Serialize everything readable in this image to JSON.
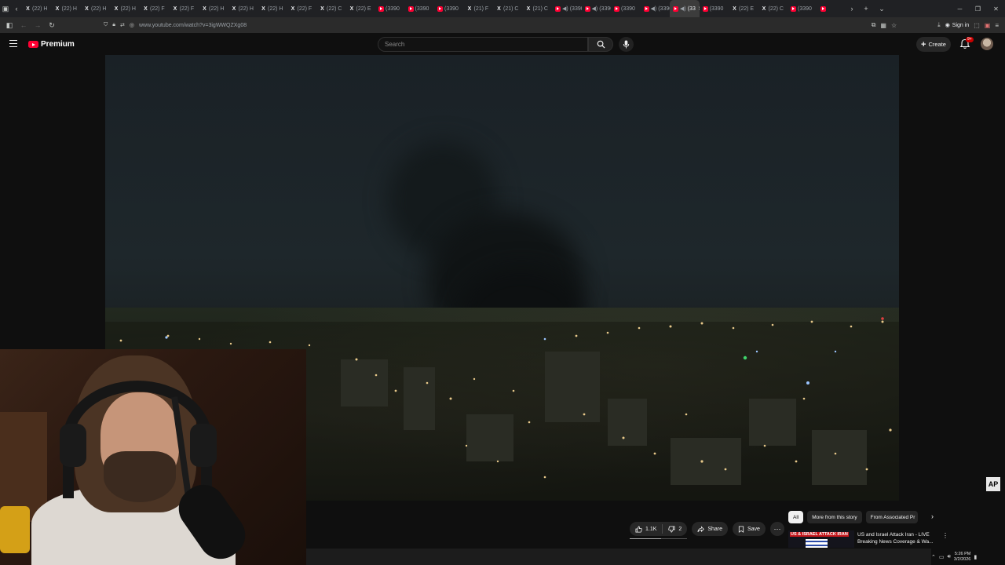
{
  "browser": {
    "tabs": [
      {
        "label": "(22) H",
        "icon": "x-icon"
      },
      {
        "label": "(22) H",
        "icon": "x-icon"
      },
      {
        "label": "(22) H",
        "icon": "x-icon"
      },
      {
        "label": "(22) H",
        "icon": "x-icon"
      },
      {
        "label": "(22) F",
        "icon": "x-icon"
      },
      {
        "label": "(22) F",
        "icon": "x-icon"
      },
      {
        "label": "(22) H",
        "icon": "x-icon"
      },
      {
        "label": "(22) H",
        "icon": "x-icon"
      },
      {
        "label": "(22) H",
        "icon": "x-icon"
      },
      {
        "label": "(22) F",
        "icon": "x-icon"
      },
      {
        "label": "(22) C",
        "icon": "x-icon"
      },
      {
        "label": "(22) E",
        "icon": "x-icon"
      },
      {
        "label": "(3390",
        "icon": "youtube-icon"
      },
      {
        "label": "(3390",
        "icon": "youtube-icon"
      },
      {
        "label": "(3390",
        "icon": "youtube-icon"
      },
      {
        "label": "(21) F",
        "icon": "x-icon"
      },
      {
        "label": "(21) C",
        "icon": "x-icon"
      },
      {
        "label": "(21) C",
        "icon": "x-icon"
      },
      {
        "label": "(3390",
        "icon": "youtube-icon",
        "audio": true
      },
      {
        "label": "(3390",
        "icon": "youtube-icon",
        "audio": true
      },
      {
        "label": "(3390",
        "icon": "youtube-icon"
      },
      {
        "label": "(3390",
        "icon": "youtube-icon",
        "audio": true
      },
      {
        "label": "(33",
        "icon": "youtube-icon",
        "audio": true,
        "active": true
      },
      {
        "label": "(3390",
        "icon": "youtube-icon"
      },
      {
        "label": "(22) E",
        "icon": "x-icon"
      },
      {
        "label": "(22) C",
        "icon": "x-icon"
      },
      {
        "label": "(3390",
        "icon": "youtube-icon"
      },
      {
        "label": "",
        "icon": "youtube-icon"
      }
    ],
    "url": "www.youtube.com/watch?v=3igWWQZXg08",
    "signin_label": "Sign in"
  },
  "youtube": {
    "logo_text": "Premium",
    "search_placeholder": "Search",
    "create_label": "Create",
    "notification_badge": "9+",
    "video_badge": "AP",
    "actions": {
      "likes": "1.1K",
      "dislikes": "2",
      "share": "Share",
      "save": "Save"
    },
    "chips": [
      "All",
      "More from this story",
      "From Associated Pr"
    ],
    "recommended": {
      "thumb_tag": "US & ISRAEL ATTACK IRAN",
      "title_line1": "US and Israel Attack Iran - LIVE",
      "title_line2": "Breaking News Coverage & Wa..."
    }
  },
  "tray": {
    "time": "5:26 PM",
    "date": "3/2/2026"
  },
  "colors": {
    "youtube_red": "#ff0033",
    "background": "#0f0f0f",
    "pill": "#272727"
  }
}
